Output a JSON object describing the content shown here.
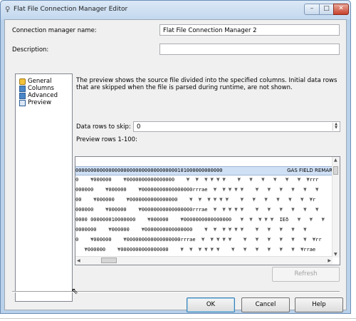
{
  "window": {
    "title": "Flat File Connection Manager Editor",
    "controls": {
      "minimize": "–",
      "maximize": "□",
      "close": "✕"
    }
  },
  "form": {
    "name_label": "Connection manager name:",
    "name_value": "Flat File Connection Manager 2",
    "description_label": "Description:",
    "description_value": ""
  },
  "nav": {
    "items": [
      {
        "label": "General",
        "icon": "general-icon"
      },
      {
        "label": "Columns",
        "icon": "columns-icon"
      },
      {
        "label": "Advanced",
        "icon": "advanced-icon"
      },
      {
        "label": "Preview",
        "icon": "preview-icon"
      }
    ]
  },
  "preview": {
    "description": "The preview shows the source file divided into the specified columns. Initial data rows that are skipped when the file is parsed during runtime, are not shown.",
    "skip_label": "Data rows to skip:",
    "skip_value": "0",
    "rows_label": "Preview rows 1-100:",
    "rows": [
      {
        "text": "0000000000000000000000000000000000101000000000000",
        "extra": "GAS FIELD REMAR",
        "selected": true
      },
      {
        "text": "0    ¥000000    ¥0000000000000000    ¥  ¥  ¥ ¥ ¥ ¥    ¥   ¥   ¥   ¥   ¥   ¥  ¥rrr",
        "selected": false
      },
      {
        "text": "000000    ¥000000    ¥00000000000000000rrrae  ¥  ¥ ¥ ¥ ¥    ¥   ¥   ¥   ¥   ¥   ¥",
        "selected": false
      },
      {
        "text": "00    ¥000000    ¥0000000000000000    ¥  ¥  ¥ ¥ ¥ ¥    ¥   ¥   ¥   ¥   ¥   ¥  ¥r",
        "selected": false
      },
      {
        "text": "000000    ¥000000    ¥00000000000000000rrrae  ¥  ¥ ¥ ¥ ¥    ¥   ¥   ¥   ¥   ¥   ¥",
        "selected": false
      },
      {
        "text": "0000 000000010000000    ¥000000    ¥0000000000000000   ¥  ¥  ¥ ¥ ¥  IEð   ¥   ¥   ¥",
        "selected": false
      },
      {
        "text": "0000000    ¥000000    ¥0000000000000000    ¥  ¥  ¥ ¥ ¥ ¥    ¥   ¥   ¥   ¥   ¥",
        "selected": false
      },
      {
        "text": "0    ¥000000    ¥000000000000000000rrrae  ¥  ¥ ¥ ¥ ¥    ¥   ¥   ¥   ¥   ¥   ¥  ¥rr",
        "selected": false
      },
      {
        "text": "   ¥000000    ¥0000000000000000    ¥  ¥  ¥ ¥ ¥ ¥    ¥   ¥   ¥   ¥   ¥   ¥  ¥rrae",
        "selected": false
      }
    ]
  },
  "buttons": {
    "refresh": "Refresh",
    "ok": "OK",
    "cancel": "Cancel",
    "help": "Help"
  },
  "colors": {
    "selection": "#cfe0f5",
    "title_bar": "#c3d8ee",
    "close_button": "#c7412b"
  }
}
